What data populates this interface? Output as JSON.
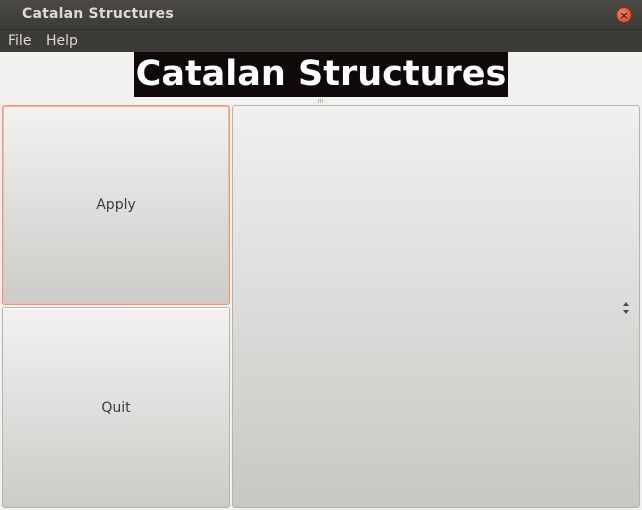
{
  "window": {
    "title": "Catalan Structures"
  },
  "menubar": {
    "items": [
      "File",
      "Help"
    ]
  },
  "heading": {
    "text": "Catalan Structures"
  },
  "buttons": {
    "apply_label": "Apply",
    "quit_label": "Quit"
  },
  "icons": {
    "close": "close-icon",
    "spinner": "spinner-arrows-icon"
  },
  "colors": {
    "accent": "#e05a35",
    "heading_bg": "#110909",
    "titlebar_bg": "#3c3b37"
  }
}
